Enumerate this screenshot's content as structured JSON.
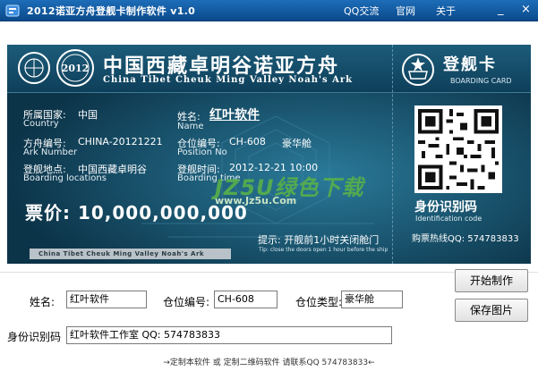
{
  "window": {
    "title": "2012诺亚方舟登舰卡制作软件 v1.0",
    "menu": [
      "QQ交流",
      "官网",
      "关于"
    ],
    "controls": [
      "_",
      "×"
    ]
  },
  "ticket": {
    "header_cn": "中国西藏卓明谷诺亚方舟",
    "header_en": "China Tibet Cheuk Ming Valley Noah's Ark",
    "logo_year": "2012",
    "card_title": "登舰卡",
    "card_sub": "BOARDING CARD",
    "country_label": "所属国家:",
    "country_value": "中国",
    "country_en": "Country",
    "name_label": "姓名:",
    "name_value": "红叶软件",
    "name_en": "Name",
    "ark_label": "方舟编号:",
    "ark_value": "CHINA-20121221",
    "ark_en": "Ark Number",
    "position_label": "仓位编号:",
    "position_value": "CH-608",
    "cabin_type": "豪华舱",
    "position_en": "Position No",
    "boarding_label": "登舰地点:",
    "boarding_value": "中国西藏卓明谷",
    "boarding_en": "Boarding locations",
    "time_label": "登舰时间:",
    "time_value": "2012-12-21 10:00",
    "time_en": "Boarding time",
    "price": "票价: 10,000,000,000",
    "id_code": "身份识别码",
    "id_code_en": "Identification code",
    "hotline": "购票热线QQ: 574783833",
    "tip": "提示: 开舰前1小时关闭舱门",
    "tip_en": "Tip: close the doors open 1 hour before the ship",
    "strip": "China Tibet Cheuk Ming Valley Noah's Ark",
    "watermark": "JZ5U绿色下载",
    "watermark_url": "www.Jz5u.Com"
  },
  "form": {
    "name_label": "姓名:",
    "name_value": "红叶软件",
    "position_label": "仓位编号:",
    "position_value": "CH-608",
    "type_label": "仓位类型:",
    "type_value": "豪华舱",
    "id_label": "身份识别码",
    "id_value": "红叶软件工作室 QQ: 574783833"
  },
  "buttons": {
    "start": "开始制作",
    "save": "保存图片"
  },
  "footer": "→定制本软件 或 定制二维码软件 请联系QQ 574783833←",
  "colors": {
    "titlebar": "#0f5aa3",
    "ticket_bg": "#0f3f58",
    "watermark": "#58b04a"
  }
}
